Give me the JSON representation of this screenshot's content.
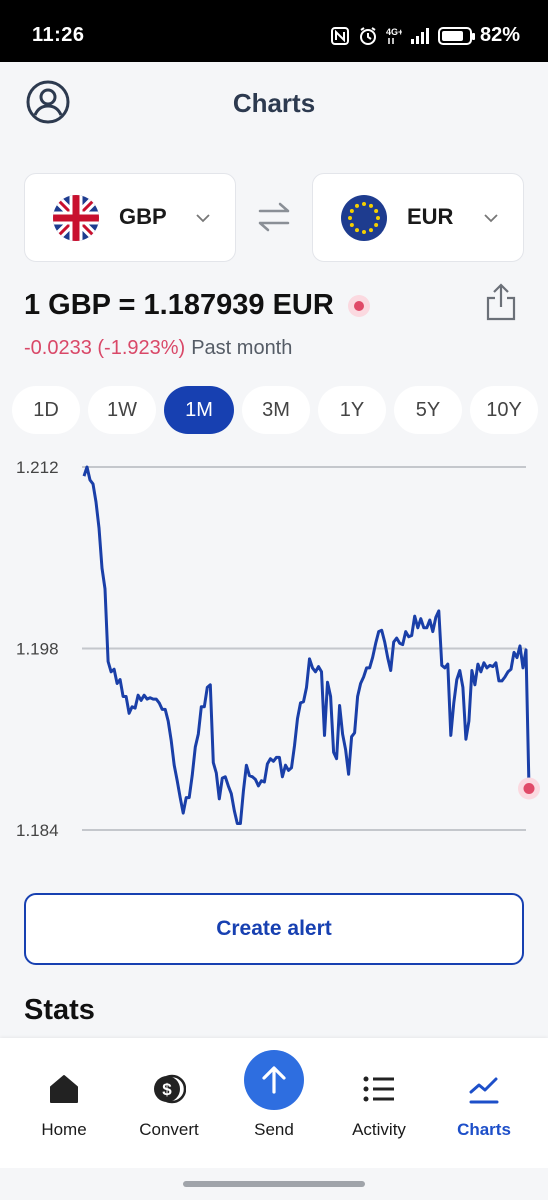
{
  "status_bar": {
    "time": "11:26",
    "battery_percent": "82%",
    "battery_level": 0.82,
    "network_label": "4G+",
    "icons": [
      "nfc-icon",
      "alarm-icon",
      "network-4g-icon",
      "signal-icon",
      "battery-icon"
    ]
  },
  "header": {
    "title": "Charts",
    "profile_icon": "profile-icon"
  },
  "currency_pair": {
    "from": {
      "code": "GBP",
      "flag": "uk-flag-icon"
    },
    "to": {
      "code": "EUR",
      "flag": "eu-flag-icon"
    },
    "swap_icon": "swap-arrows-icon"
  },
  "rate": {
    "text": "1 GBP = 1.187939 EUR",
    "change": "-0.0233 (-1.923%)",
    "period": "Past month",
    "share_icon": "share-icon"
  },
  "ranges": [
    {
      "label": "1D",
      "active": false
    },
    {
      "label": "1W",
      "active": false
    },
    {
      "label": "1M",
      "active": true
    },
    {
      "label": "3M",
      "active": false
    },
    {
      "label": "1Y",
      "active": false
    },
    {
      "label": "5Y",
      "active": false
    },
    {
      "label": "10Y",
      "active": false
    }
  ],
  "chart_data": {
    "type": "line",
    "title": "",
    "xlabel": "",
    "ylabel": "",
    "y_ticks": [
      "1.212",
      "1.198",
      "1.184"
    ],
    "ylim": [
      1.184,
      1.212
    ],
    "grid": true,
    "line_color": "#1a3fa8",
    "end_marker_color": "#e04a68",
    "series": [
      {
        "x": [
          0,
          1,
          2,
          3,
          4,
          5,
          6,
          7,
          8,
          9,
          10,
          11,
          12,
          13,
          14,
          15,
          16,
          17,
          18,
          19,
          20,
          21,
          22,
          23,
          24,
          25,
          26,
          27,
          28,
          29,
          30,
          31,
          32,
          33,
          34,
          35,
          36,
          37,
          38,
          39,
          40,
          41,
          42,
          43,
          44,
          45,
          46,
          47,
          48,
          49,
          50,
          51,
          52,
          53,
          54,
          55,
          56,
          57,
          58,
          59,
          60,
          61,
          62,
          63,
          64,
          65,
          66,
          67,
          68,
          69,
          70,
          71,
          72,
          73,
          74,
          75,
          76,
          77,
          78,
          79,
          80,
          81,
          82,
          83,
          84,
          85,
          86,
          87,
          88,
          89,
          90,
          91,
          92,
          93,
          94,
          95,
          96,
          97,
          98,
          99,
          100,
          101,
          102,
          103,
          104,
          105,
          106,
          107,
          108,
          109,
          110,
          111,
          112,
          113,
          114,
          115,
          116,
          117,
          118,
          119,
          120,
          121,
          122,
          123,
          124,
          125,
          126,
          127,
          128,
          129,
          130,
          131,
          132,
          133,
          134,
          135,
          136,
          137,
          138,
          139,
          140,
          141,
          142,
          143,
          144,
          145,
          146,
          147,
          148
        ],
        "values": [
          1.2113,
          1.212,
          1.211,
          1.2107,
          1.2093,
          1.2073,
          1.2042,
          1.2026,
          1.197,
          1.1962,
          1.1964,
          1.1953,
          1.1956,
          1.1943,
          1.1943,
          1.193,
          1.1935,
          1.1934,
          1.1944,
          1.194,
          1.1944,
          1.1941,
          1.1942,
          1.1941,
          1.1941,
          1.1938,
          1.1933,
          1.1933,
          1.1924,
          1.1909,
          1.189,
          1.1878,
          1.1865,
          1.1853,
          1.1865,
          1.1865,
          1.1882,
          1.1904,
          1.1914,
          1.1935,
          1.1935,
          1.195,
          1.1952,
          1.1892,
          1.1884,
          1.1864,
          1.188,
          1.1881,
          1.1874,
          1.1868,
          1.1855,
          1.1845,
          1.1845,
          1.187,
          1.189,
          1.1882,
          1.1881,
          1.1879,
          1.1874,
          1.1878,
          1.1877,
          1.1891,
          1.1895,
          1.1893,
          1.1896,
          1.1896,
          1.1881,
          1.189,
          1.1886,
          1.1888,
          1.1905,
          1.1926,
          1.1938,
          1.1939,
          1.195,
          1.1972,
          1.1965,
          1.1962,
          1.1966,
          1.1962,
          1.1913,
          1.1954,
          1.1943,
          1.19,
          1.1895,
          1.1936,
          1.1914,
          1.1902,
          1.1883,
          1.1912,
          1.1915,
          1.1943,
          1.1953,
          1.1958,
          1.1965,
          1.1965,
          1.1973,
          1.1984,
          1.1993,
          1.1994,
          1.1985,
          1.1973,
          1.1963,
          1.1985,
          1.1988,
          1.1984,
          1.1983,
          1.1993,
          1.1989,
          1.199,
          1.2005,
          1.1996,
          1.2003,
          1.1996,
          1.1996,
          1.2002,
          1.1993,
          1.2004,
          1.2009,
          1.1967,
          1.1965,
          1.1968,
          1.1913,
          1.1938,
          1.1956,
          1.1963,
          1.195,
          1.191,
          1.1924,
          1.1963,
          1.1952,
          1.1968,
          1.1962,
          1.1969,
          1.1965,
          1.1967,
          1.1966,
          1.1969,
          1.1955,
          1.1955,
          1.1958,
          1.1962,
          1.1964,
          1.1977,
          1.1973,
          1.1982,
          1.1965,
          1.1979,
          1.1872
        ]
      }
    ]
  },
  "alert_button": {
    "label": "Create alert"
  },
  "stats": {
    "title": "Stats"
  },
  "bottom_nav": [
    {
      "label": "Home",
      "icon": "home-icon",
      "active": false
    },
    {
      "label": "Convert",
      "icon": "convert-icon",
      "active": false
    },
    {
      "label": "Send",
      "icon": "send-arrow-icon",
      "active": false
    },
    {
      "label": "Activity",
      "icon": "activity-list-icon",
      "active": false
    },
    {
      "label": "Charts",
      "icon": "charts-icon",
      "active": true
    }
  ]
}
